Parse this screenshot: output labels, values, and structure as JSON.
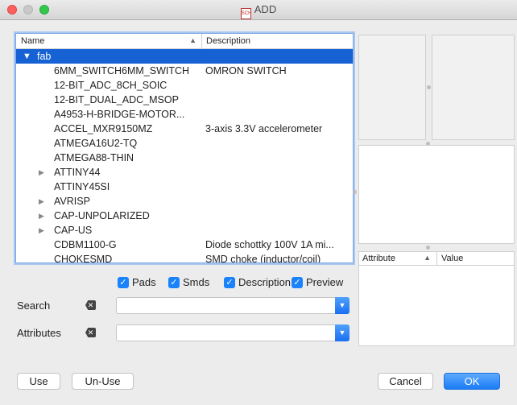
{
  "window": {
    "title": "ADD"
  },
  "tree": {
    "columns": {
      "name": "Name",
      "description": "Description"
    },
    "root": {
      "label": "fab"
    },
    "items": [
      {
        "name": "6MM_SWITCH6MM_SWITCH",
        "description": "OMRON SWITCH",
        "expandable": false
      },
      {
        "name": "12-BIT_ADC_8CH_SOIC",
        "description": "",
        "expandable": false
      },
      {
        "name": "12-BIT_DUAL_ADC_MSOP",
        "description": "",
        "expandable": false
      },
      {
        "name": "A4953-H-BRIDGE-MOTOR...",
        "description": "",
        "expandable": false
      },
      {
        "name": "ACCEL_MXR9150MZ",
        "description": "3-axis 3.3V accelerometer",
        "expandable": false
      },
      {
        "name": "ATMEGA16U2-TQ",
        "description": "",
        "expandable": false
      },
      {
        "name": "ATMEGA88-THIN",
        "description": "",
        "expandable": false
      },
      {
        "name": "ATTINY44",
        "description": "",
        "expandable": true
      },
      {
        "name": "ATTINY45SI",
        "description": "",
        "expandable": false
      },
      {
        "name": "AVRISP",
        "description": "",
        "expandable": true
      },
      {
        "name": "CAP-UNPOLARIZED",
        "description": "",
        "expandable": true
      },
      {
        "name": "CAP-US",
        "description": "",
        "expandable": true
      },
      {
        "name": "CDBM1100-G",
        "description": "Diode schottky 100V 1A mi...",
        "expandable": false
      },
      {
        "name": "CHOKESMD",
        "description": "SMD choke (inductor/coil)",
        "expandable": false
      }
    ]
  },
  "attributes_table": {
    "columns": {
      "attribute": "Attribute",
      "value": "Value"
    }
  },
  "checkboxes": [
    {
      "label": "Pads",
      "checked": true
    },
    {
      "label": "Smds",
      "checked": true
    },
    {
      "label": "Description",
      "checked": true
    },
    {
      "label": "Preview",
      "checked": true
    }
  ],
  "search": {
    "label": "Search",
    "value": ""
  },
  "attributes_filter": {
    "label": "Attributes",
    "value": ""
  },
  "buttons": {
    "use": "Use",
    "unuse": "Un-Use",
    "cancel": "Cancel",
    "ok": "OK"
  },
  "colors": {
    "accent": "#1662d5",
    "checkbox": "#1a82fb"
  }
}
